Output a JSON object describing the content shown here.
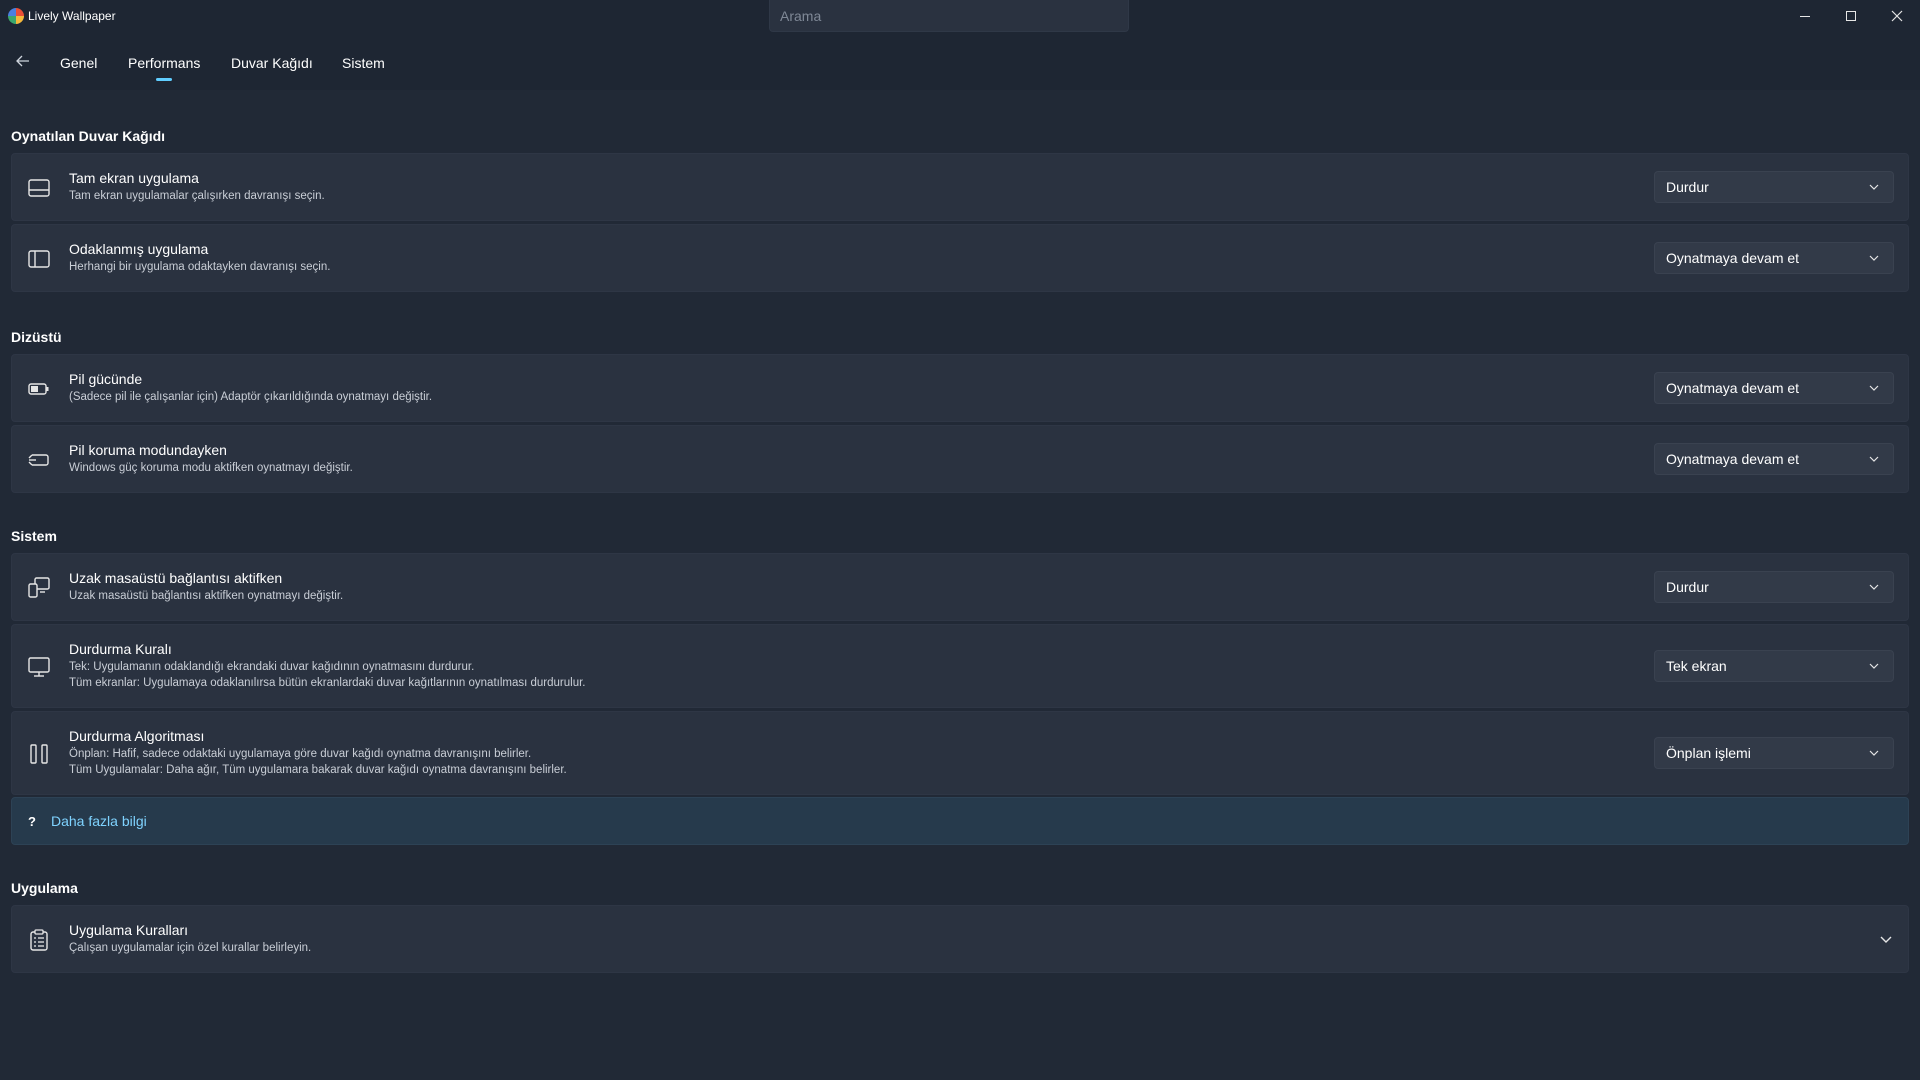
{
  "app": {
    "title": "Lively Wallpaper"
  },
  "search": {
    "placeholder": "Arama"
  },
  "nav": {
    "tabs": [
      {
        "label": "Genel"
      },
      {
        "label": "Performans"
      },
      {
        "label": "Duvar Kağıdı"
      },
      {
        "label": "Sistem"
      }
    ],
    "selected": "Performans"
  },
  "sections": {
    "playing": {
      "title": "Oynatılan Duvar Kağıdı",
      "fullscreen": {
        "title": "Tam ekran uygulama",
        "desc": "Tam ekran uygulamalar çalışırken davranışı seçin.",
        "value": "Durdur"
      },
      "focused": {
        "title": "Odaklanmış uygulama",
        "desc": "Herhangi bir uygulama odaktayken davranışı seçin.",
        "value": "Oynatmaya devam et"
      }
    },
    "laptop": {
      "title": "Dizüstü",
      "battery": {
        "title": "Pil gücünde",
        "desc": "(Sadece pil ile çalışanlar için) Adaptör çıkarıldığında oynatmayı değiştir.",
        "value": "Oynatmaya devam et"
      },
      "saver": {
        "title": "Pil koruma modundayken",
        "desc": "Windows güç koruma modu aktifken oynatmayı değiştir.",
        "value": "Oynatmaya devam et"
      }
    },
    "system": {
      "title": "Sistem",
      "remote": {
        "title": "Uzak masaüstü bağlantısı aktifken",
        "desc": "Uzak masaüstü bağlantısı aktifken oynatmayı değiştir.",
        "value": "Durdur"
      },
      "pause_rule": {
        "title": "Durdurma Kuralı",
        "desc1": "Tek: Uygulamanın odaklandığı ekrandaki duvar kağıdının oynatmasını durdurur.",
        "desc2": "Tüm ekranlar: Uygulamaya odaklanılırsa bütün ekranlardaki duvar kağıtlarının oynatılması durdurulur.",
        "value": "Tek ekran"
      },
      "pause_algo": {
        "title": "Durdurma Algoritması",
        "desc1": "Önplan: Hafif, sadece odaktaki uygulamaya göre duvar kağıdı oynatma davranışını belirler.",
        "desc2": "Tüm Uygulamalar: Daha ağır, Tüm uygulamara bakarak duvar kağıdı oynatma davranışını belirler.",
        "value": "Önplan işlemi"
      },
      "info": {
        "icon": "?",
        "link": "Daha fazla bilgi"
      }
    },
    "app": {
      "title": "Uygulama",
      "rules": {
        "title": "Uygulama Kuralları",
        "desc": "Çalışan uygulamalar için özel kurallar belirleyin."
      }
    }
  },
  "icons": {
    "back": "arrow-left-icon",
    "fullscreen": "fullscreen-app-icon",
    "focused": "focused-window-icon",
    "battery": "battery-icon",
    "saver": "battery-saver-icon",
    "remote": "remote-desktop-icon",
    "monitor": "monitor-icon",
    "pause": "pause-icon",
    "rules": "clipboard-list-icon"
  },
  "colors": {
    "accent": "#60cdff",
    "background": "#212936",
    "card": "#2a3240",
    "info_bar": "#263a4c"
  }
}
